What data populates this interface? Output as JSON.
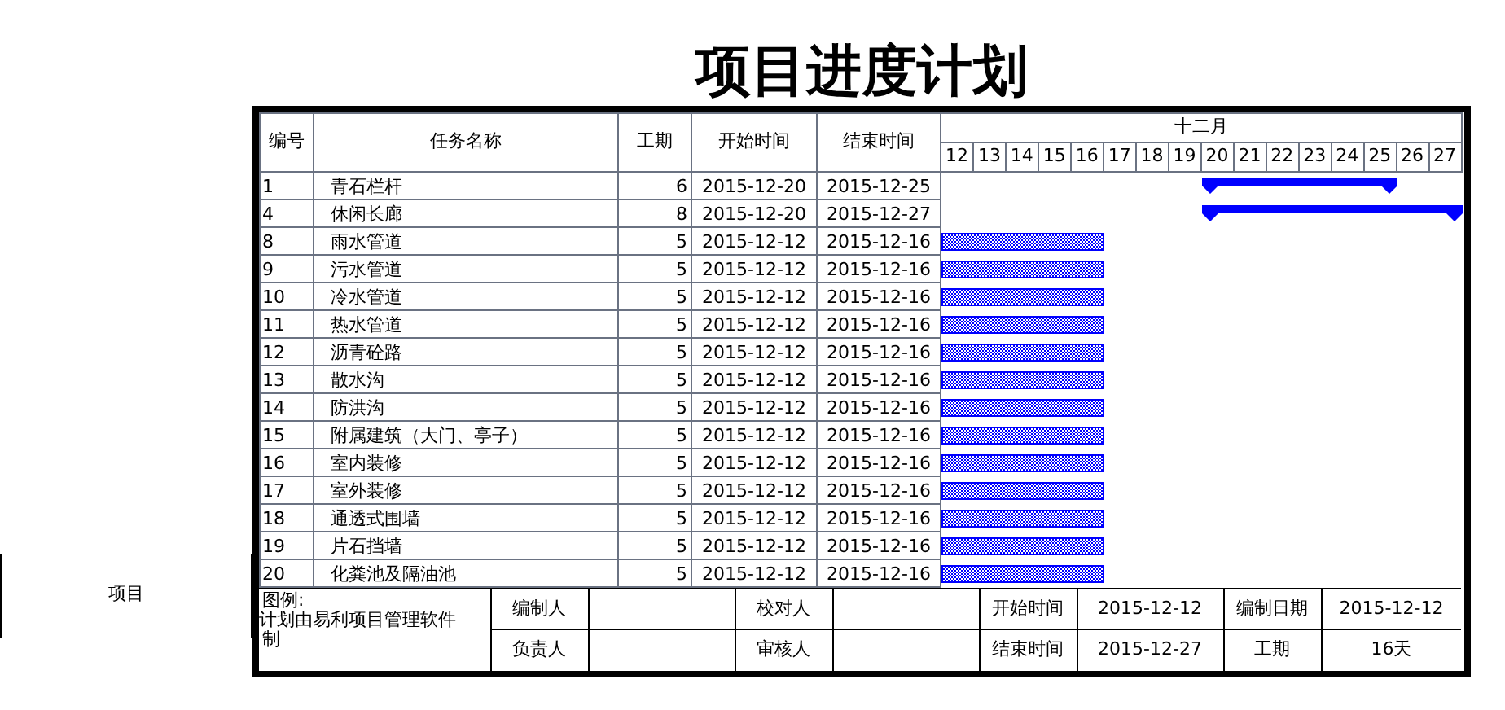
{
  "title": "项目进度计划",
  "side_label": "项目",
  "columns": [
    "编号",
    "任务名称",
    "工期",
    "开始时间",
    "结束时间"
  ],
  "month": "十二月",
  "days": [
    "12",
    "13",
    "14",
    "15",
    "16",
    "17",
    "18",
    "19",
    "20",
    "21",
    "22",
    "23",
    "24",
    "25",
    "26",
    "27"
  ],
  "tasks": [
    {
      "id": "1",
      "name": "青石栏杆",
      "duration": "6",
      "start": "2015-12-20",
      "end": "2015-12-25",
      "kind": "summary"
    },
    {
      "id": "4",
      "name": "休闲长廊",
      "duration": "8",
      "start": "2015-12-20",
      "end": "2015-12-27",
      "kind": "summary"
    },
    {
      "id": "8",
      "name": "雨水管道",
      "duration": "5",
      "start": "2015-12-12",
      "end": "2015-12-16",
      "kind": "task"
    },
    {
      "id": "9",
      "name": "污水管道",
      "duration": "5",
      "start": "2015-12-12",
      "end": "2015-12-16",
      "kind": "task"
    },
    {
      "id": "10",
      "name": "冷水管道",
      "duration": "5",
      "start": "2015-12-12",
      "end": "2015-12-16",
      "kind": "task"
    },
    {
      "id": "11",
      "name": "热水管道",
      "duration": "5",
      "start": "2015-12-12",
      "end": "2015-12-16",
      "kind": "task"
    },
    {
      "id": "12",
      "name": "沥青砼路",
      "duration": "5",
      "start": "2015-12-12",
      "end": "2015-12-16",
      "kind": "task"
    },
    {
      "id": "13",
      "name": "散水沟",
      "duration": "5",
      "start": "2015-12-12",
      "end": "2015-12-16",
      "kind": "task"
    },
    {
      "id": "14",
      "name": "防洪沟",
      "duration": "5",
      "start": "2015-12-12",
      "end": "2015-12-16",
      "kind": "task"
    },
    {
      "id": "15",
      "name": "附属建筑（大门、亭子）",
      "duration": "5",
      "start": "2015-12-12",
      "end": "2015-12-16",
      "kind": "task"
    },
    {
      "id": "16",
      "name": "室内装修",
      "duration": "5",
      "start": "2015-12-12",
      "end": "2015-12-16",
      "kind": "task"
    },
    {
      "id": "17",
      "name": "室外装修",
      "duration": "5",
      "start": "2015-12-12",
      "end": "2015-12-16",
      "kind": "task"
    },
    {
      "id": "18",
      "name": "通透式围墙",
      "duration": "5",
      "start": "2015-12-12",
      "end": "2015-12-16",
      "kind": "task"
    },
    {
      "id": "19",
      "name": "片石挡墙",
      "duration": "5",
      "start": "2015-12-12",
      "end": "2015-12-16",
      "kind": "task"
    },
    {
      "id": "20",
      "name": "化粪池及隔油池",
      "duration": "5",
      "start": "2015-12-12",
      "end": "2015-12-16",
      "kind": "task"
    }
  ],
  "footer": {
    "legend_label": "图例:",
    "note": "计划由易利项目管理软件",
    "note_continued": "制",
    "rows": [
      [
        "编制人",
        "",
        "校对人",
        "",
        "开始时间",
        "2015-12-12",
        "编制日期",
        "2015-12-12"
      ],
      [
        "负责人",
        "",
        "审核人",
        "",
        "结束时间",
        "2015-12-27",
        "工期",
        "16天"
      ]
    ]
  }
}
